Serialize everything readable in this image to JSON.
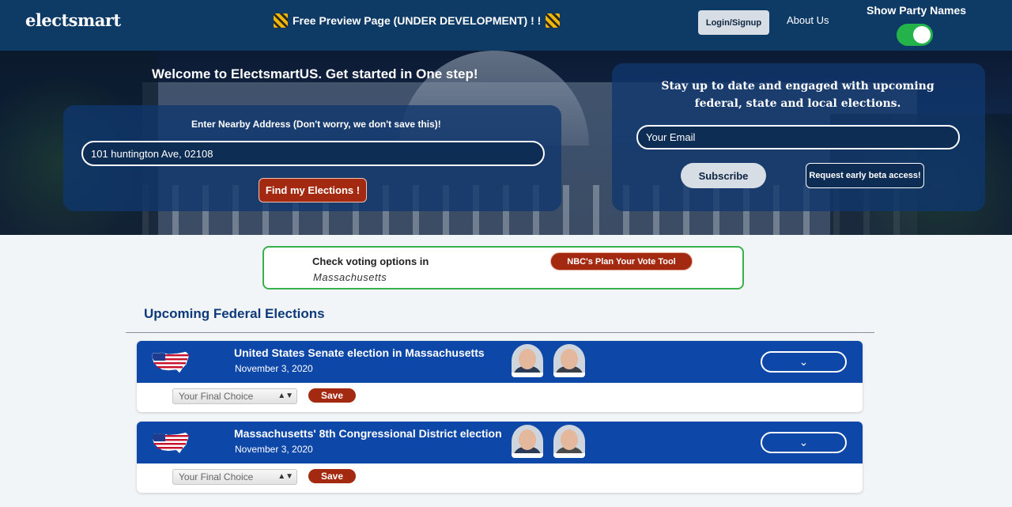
{
  "header": {
    "logo": "electsmart",
    "preview_banner": "Free Preview Page (UNDER DEVELOPMENT) ! !",
    "login_label": "Login/Signup",
    "about_label": "About Us",
    "party_toggle_label": "Show Party Names",
    "party_toggle_on": true
  },
  "hero": {
    "welcome": "Welcome to ElectsmartUS. Get started in One step!",
    "address_label": "Enter Nearby Address (Don't worry, we don't save this)!",
    "address_value": "101 huntington Ave, 02108",
    "find_label": "Find my Elections !",
    "subscribe_text": "Stay up to date and engaged with upcoming federal, state and local elections.",
    "email_placeholder": "Your Email",
    "subscribe_label": "Subscribe",
    "beta_label": "Request early beta access!"
  },
  "voting_options": {
    "title": "Check voting options in",
    "state": "Massachusetts",
    "nbc_label": "NBC's Plan Your Vote Tool"
  },
  "section_title": "Upcoming Federal Elections",
  "elections": [
    {
      "title": "United States Senate election in Massachusetts",
      "date": "November 3, 2020",
      "choice_placeholder": "Your Final Choice",
      "save_label": "Save",
      "expand_icon": "chevron-down-icon"
    },
    {
      "title": "Massachusetts' 8th Congressional District election",
      "date": "November 3, 2020",
      "choice_placeholder": "Your Final Choice",
      "save_label": "Save",
      "expand_icon": "chevron-down-icon"
    }
  ],
  "colors": {
    "header_bg": "#0e3a66",
    "card_header": "#0d47a8",
    "accent_red": "#a32a10",
    "toggle_on": "#24b34b",
    "vote_border": "#38b04c"
  }
}
